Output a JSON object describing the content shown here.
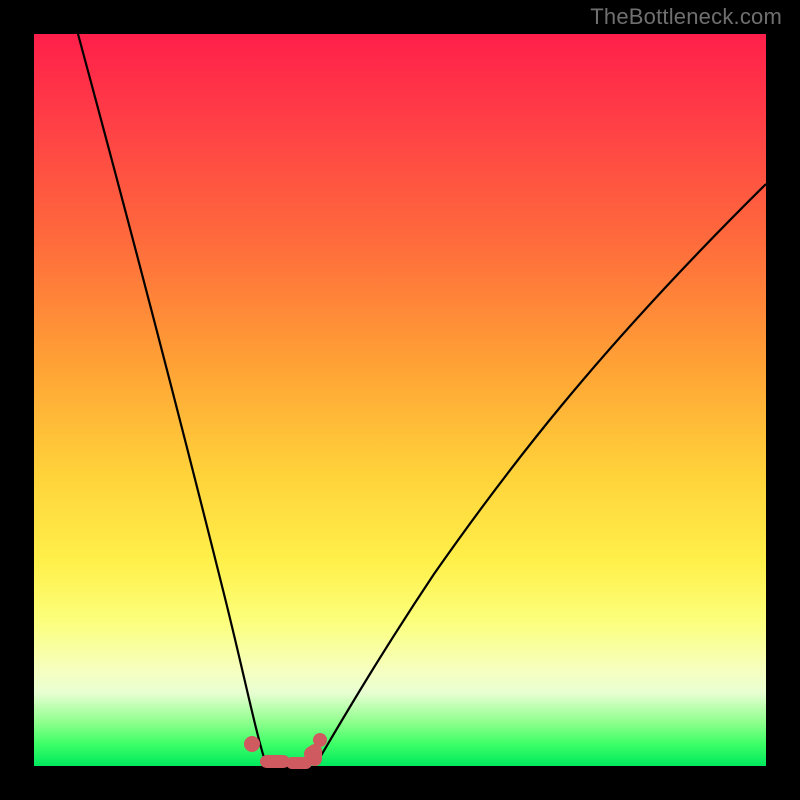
{
  "watermark": "TheBottleneck.com",
  "chart_data": {
    "type": "line",
    "title": "",
    "xlabel": "",
    "ylabel": "",
    "xlim": [
      0,
      100
    ],
    "ylim": [
      0,
      100
    ],
    "grid": false,
    "legend": false,
    "series": [
      {
        "name": "left-curve",
        "x": [
          6,
          10,
          14,
          18,
          22,
          24,
          26,
          28,
          30,
          31.5
        ],
        "y": [
          100,
          80,
          58,
          38,
          18,
          10,
          5,
          2,
          0.5,
          0
        ]
      },
      {
        "name": "right-curve",
        "x": [
          38,
          40,
          44,
          50,
          58,
          68,
          80,
          92,
          100
        ],
        "y": [
          0,
          2,
          8,
          18,
          32,
          48,
          62,
          73,
          80
        ]
      },
      {
        "name": "bottom-marks",
        "type": "scatter",
        "x": [
          29.5,
          31.5,
          33,
          34.5,
          36,
          37.5,
          38.5
        ],
        "y": [
          2.5,
          0.4,
          0.2,
          0.2,
          0.3,
          1.0,
          2.2
        ]
      }
    ],
    "colors": {
      "curve_stroke": "#000000",
      "mark_fill": "#cf5a60",
      "gradient_top": "#ff1f4a",
      "gradient_bottom": "#00e85e"
    }
  }
}
